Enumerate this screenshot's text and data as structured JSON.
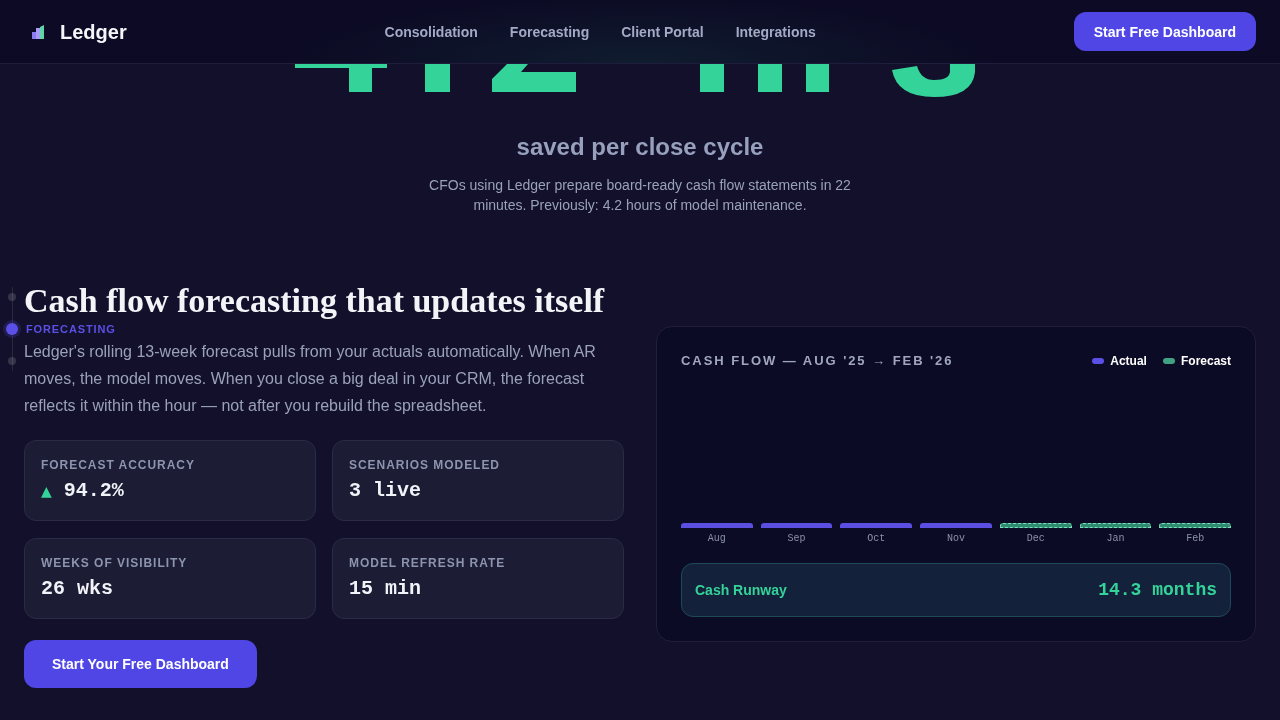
{
  "header": {
    "logo_text": "Ledger",
    "nav_links": [
      "Consolidation",
      "Forecasting",
      "Client Portal",
      "Integrations"
    ],
    "cta": "Start Free Dashboard"
  },
  "hero": {
    "caption": "saved per close cycle",
    "description": "CFOs using Ledger prepare board-ready cash flow statements in 22 minutes. Previously: 4.2 hours of model maintenance."
  },
  "section_nav": [
    {
      "selected": false
    },
    {
      "selected": true,
      "label": "FORECASTING"
    },
    {
      "selected": false
    }
  ],
  "feature": {
    "heading": "Cash flow forecasting that updates itself",
    "body": "Ledger's rolling 13-week forecast pulls from your actuals automatically. When AR moves, the model moves. When you close a big deal in your CRM, the forecast reflects it within the hour — not after you rebuild the spreadsheet.",
    "stats": [
      {
        "label": "FORECAST ACCURACY",
        "indicator": "▲",
        "value": "94.2%"
      },
      {
        "label": "SCENARIOS MODELED",
        "value": "3 live"
      },
      {
        "label": "WEEKS OF VISIBILITY",
        "value": "26 wks"
      },
      {
        "label": "MODEL REFRESH RATE",
        "value": "15 min"
      }
    ],
    "cta": "Start Your Free Dashboard"
  },
  "chart_panel": {
    "title": "CASH FLOW — AUG '25 → FEB '26",
    "legend": [
      {
        "label": "Actual",
        "color": "#5b50e6"
      },
      {
        "label": "Forecast",
        "color": "#3fa282"
      }
    ],
    "bars": [
      {
        "label": "Aug",
        "kind": "actual"
      },
      {
        "label": "Sep",
        "kind": "actual"
      },
      {
        "label": "Oct",
        "kind": "actual"
      },
      {
        "label": "Nov",
        "kind": "actual"
      },
      {
        "label": "Dec",
        "kind": "forecast"
      },
      {
        "label": "Jan",
        "kind": "forecast"
      },
      {
        "label": "Feb",
        "kind": "forecast"
      }
    ],
    "runway": {
      "label": "Cash Runway",
      "value": "14.3 months"
    }
  }
}
